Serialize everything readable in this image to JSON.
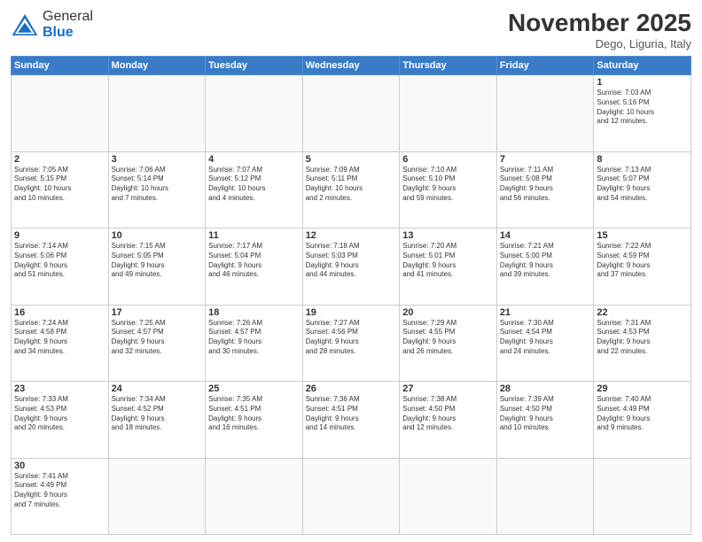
{
  "header": {
    "logo_general": "General",
    "logo_blue": "Blue",
    "month_title": "November 2025",
    "location": "Dego, Liguria, Italy"
  },
  "weekdays": [
    "Sunday",
    "Monday",
    "Tuesday",
    "Wednesday",
    "Thursday",
    "Friday",
    "Saturday"
  ],
  "weeks": [
    [
      {
        "day": "",
        "info": ""
      },
      {
        "day": "",
        "info": ""
      },
      {
        "day": "",
        "info": ""
      },
      {
        "day": "",
        "info": ""
      },
      {
        "day": "",
        "info": ""
      },
      {
        "day": "",
        "info": ""
      },
      {
        "day": "1",
        "info": "Sunrise: 7:03 AM\nSunset: 5:16 PM\nDaylight: 10 hours\nand 12 minutes."
      }
    ],
    [
      {
        "day": "2",
        "info": "Sunrise: 7:05 AM\nSunset: 5:15 PM\nDaylight: 10 hours\nand 10 minutes."
      },
      {
        "day": "3",
        "info": "Sunrise: 7:06 AM\nSunset: 5:14 PM\nDaylight: 10 hours\nand 7 minutes."
      },
      {
        "day": "4",
        "info": "Sunrise: 7:07 AM\nSunset: 5:12 PM\nDaylight: 10 hours\nand 4 minutes."
      },
      {
        "day": "5",
        "info": "Sunrise: 7:09 AM\nSunset: 5:11 PM\nDaylight: 10 hours\nand 2 minutes."
      },
      {
        "day": "6",
        "info": "Sunrise: 7:10 AM\nSunset: 5:10 PM\nDaylight: 9 hours\nand 59 minutes."
      },
      {
        "day": "7",
        "info": "Sunrise: 7:11 AM\nSunset: 5:08 PM\nDaylight: 9 hours\nand 56 minutes."
      },
      {
        "day": "8",
        "info": "Sunrise: 7:13 AM\nSunset: 5:07 PM\nDaylight: 9 hours\nand 54 minutes."
      }
    ],
    [
      {
        "day": "9",
        "info": "Sunrise: 7:14 AM\nSunset: 5:06 PM\nDaylight: 9 hours\nand 51 minutes."
      },
      {
        "day": "10",
        "info": "Sunrise: 7:15 AM\nSunset: 5:05 PM\nDaylight: 9 hours\nand 49 minutes."
      },
      {
        "day": "11",
        "info": "Sunrise: 7:17 AM\nSunset: 5:04 PM\nDaylight: 9 hours\nand 46 minutes."
      },
      {
        "day": "12",
        "info": "Sunrise: 7:18 AM\nSunset: 5:03 PM\nDaylight: 9 hours\nand 44 minutes."
      },
      {
        "day": "13",
        "info": "Sunrise: 7:20 AM\nSunset: 5:01 PM\nDaylight: 9 hours\nand 41 minutes."
      },
      {
        "day": "14",
        "info": "Sunrise: 7:21 AM\nSunset: 5:00 PM\nDaylight: 9 hours\nand 39 minutes."
      },
      {
        "day": "15",
        "info": "Sunrise: 7:22 AM\nSunset: 4:59 PM\nDaylight: 9 hours\nand 37 minutes."
      }
    ],
    [
      {
        "day": "16",
        "info": "Sunrise: 7:24 AM\nSunset: 4:58 PM\nDaylight: 9 hours\nand 34 minutes."
      },
      {
        "day": "17",
        "info": "Sunrise: 7:25 AM\nSunset: 4:57 PM\nDaylight: 9 hours\nand 32 minutes."
      },
      {
        "day": "18",
        "info": "Sunrise: 7:26 AM\nSunset: 4:57 PM\nDaylight: 9 hours\nand 30 minutes."
      },
      {
        "day": "19",
        "info": "Sunrise: 7:27 AM\nSunset: 4:56 PM\nDaylight: 9 hours\nand 28 minutes."
      },
      {
        "day": "20",
        "info": "Sunrise: 7:29 AM\nSunset: 4:55 PM\nDaylight: 9 hours\nand 26 minutes."
      },
      {
        "day": "21",
        "info": "Sunrise: 7:30 AM\nSunset: 4:54 PM\nDaylight: 9 hours\nand 24 minutes."
      },
      {
        "day": "22",
        "info": "Sunrise: 7:31 AM\nSunset: 4:53 PM\nDaylight: 9 hours\nand 22 minutes."
      }
    ],
    [
      {
        "day": "23",
        "info": "Sunrise: 7:33 AM\nSunset: 4:53 PM\nDaylight: 9 hours\nand 20 minutes."
      },
      {
        "day": "24",
        "info": "Sunrise: 7:34 AM\nSunset: 4:52 PM\nDaylight: 9 hours\nand 18 minutes."
      },
      {
        "day": "25",
        "info": "Sunrise: 7:35 AM\nSunset: 4:51 PM\nDaylight: 9 hours\nand 16 minutes."
      },
      {
        "day": "26",
        "info": "Sunrise: 7:36 AM\nSunset: 4:51 PM\nDaylight: 9 hours\nand 14 minutes."
      },
      {
        "day": "27",
        "info": "Sunrise: 7:38 AM\nSunset: 4:50 PM\nDaylight: 9 hours\nand 12 minutes."
      },
      {
        "day": "28",
        "info": "Sunrise: 7:39 AM\nSunset: 4:50 PM\nDaylight: 9 hours\nand 10 minutes."
      },
      {
        "day": "29",
        "info": "Sunrise: 7:40 AM\nSunset: 4:49 PM\nDaylight: 9 hours\nand 9 minutes."
      }
    ],
    [
      {
        "day": "30",
        "info": "Sunrise: 7:41 AM\nSunset: 4:49 PM\nDaylight: 9 hours\nand 7 minutes."
      },
      {
        "day": "",
        "info": ""
      },
      {
        "day": "",
        "info": ""
      },
      {
        "day": "",
        "info": ""
      },
      {
        "day": "",
        "info": ""
      },
      {
        "day": "",
        "info": ""
      },
      {
        "day": "",
        "info": ""
      }
    ]
  ]
}
